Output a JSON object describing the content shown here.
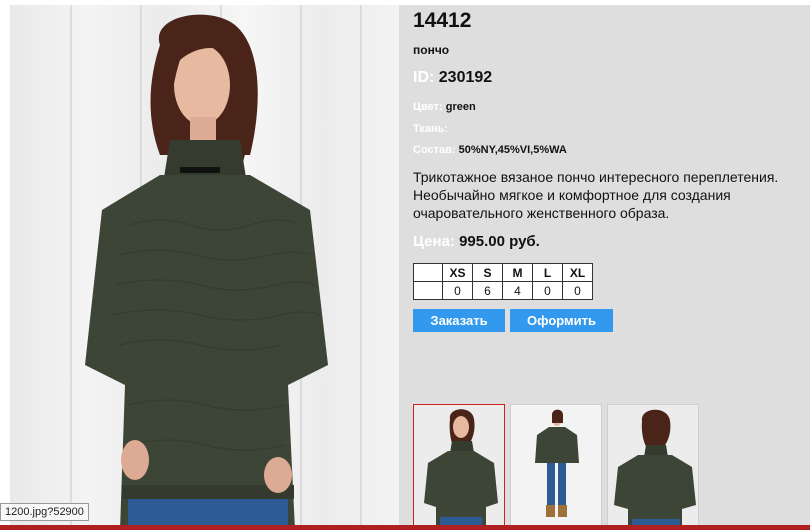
{
  "product": {
    "title": "14412",
    "subtitle": "пончо",
    "id_label": "ID:",
    "id_value": "230192",
    "color_label": "Цвет:",
    "color_value": "green",
    "fabric_label": "Ткань:",
    "fabric_value": "",
    "composition_label": "Состав:",
    "composition_value": "50%NY,45%VI,5%WA",
    "description": "Трикотажное вязаное пончо интересного переплетения. Необычайно мягкое и комфортное для создания очаровательного женственного образа.",
    "price_label": "Цена:",
    "price_value": "995.00 руб."
  },
  "sizes": {
    "headers": [
      "XS",
      "S",
      "M",
      "L",
      "XL"
    ],
    "counts": [
      "0",
      "6",
      "4",
      "0",
      "0"
    ]
  },
  "buttons": {
    "order_label": "Заказать",
    "checkout_label": "Оформить"
  },
  "status_url": "1200.jpg?52900",
  "colors": {
    "background": "#dedede",
    "button": "#3399ee",
    "label_white": "#ffffff",
    "sweater": "#3d4536",
    "jeans": "#2d5b93",
    "active_thumb_border": "#cc2222"
  }
}
